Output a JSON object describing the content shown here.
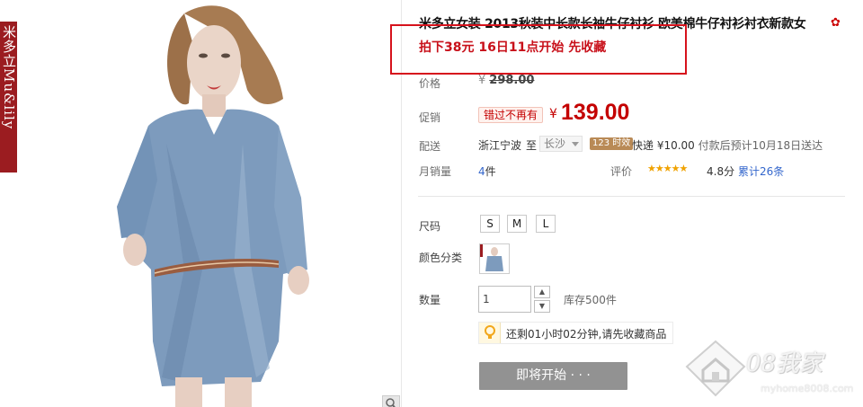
{
  "gallery": {
    "brand_text": "米多立Mu&lily"
  },
  "product": {
    "title": "米多立女装 2013秋装中长款长袖牛仔衬衫 欧美棉牛仔衬衫衬衣新款女",
    "promo_text": "拍下38元 16日11点开始 先收藏"
  },
  "price": {
    "label": "价格",
    "currency": "¥",
    "original": "298.00"
  },
  "sale": {
    "label": "促销",
    "tag": "错过不再有",
    "currency": "¥",
    "price": "139.00"
  },
  "shipping": {
    "label": "配送",
    "from": "浙江宁波",
    "to_word": "至",
    "city": "长沙",
    "timely_tag": "123 时效",
    "express": "快递 ¥10.00",
    "eta": "付款后预计10月18日送达"
  },
  "monthly_sales": {
    "label": "月销量",
    "count": "4",
    "unit": "件"
  },
  "rating": {
    "label": "评价",
    "stars": "★★★★★",
    "score": "4.8分",
    "reviews": "累计26条"
  },
  "size": {
    "label": "尺码",
    "options": [
      "S",
      "M",
      "L"
    ]
  },
  "color": {
    "label": "颜色分类"
  },
  "quantity": {
    "label": "数量",
    "value": "1",
    "up": "▲",
    "down": "▼",
    "stock": "库存500件"
  },
  "countdown": {
    "text": "还剩01小时02分钟,请先收藏商品"
  },
  "buy_button": {
    "label": "即将开始 · · ·"
  },
  "watermark": {
    "text": "08我家",
    "url": "myhome8008.com"
  },
  "colors": {
    "accent_red": "#c40000",
    "promo_box": "#d6121c",
    "link_blue": "#3366cc",
    "star": "#f0a200",
    "brand_red": "#9b1c20"
  }
}
